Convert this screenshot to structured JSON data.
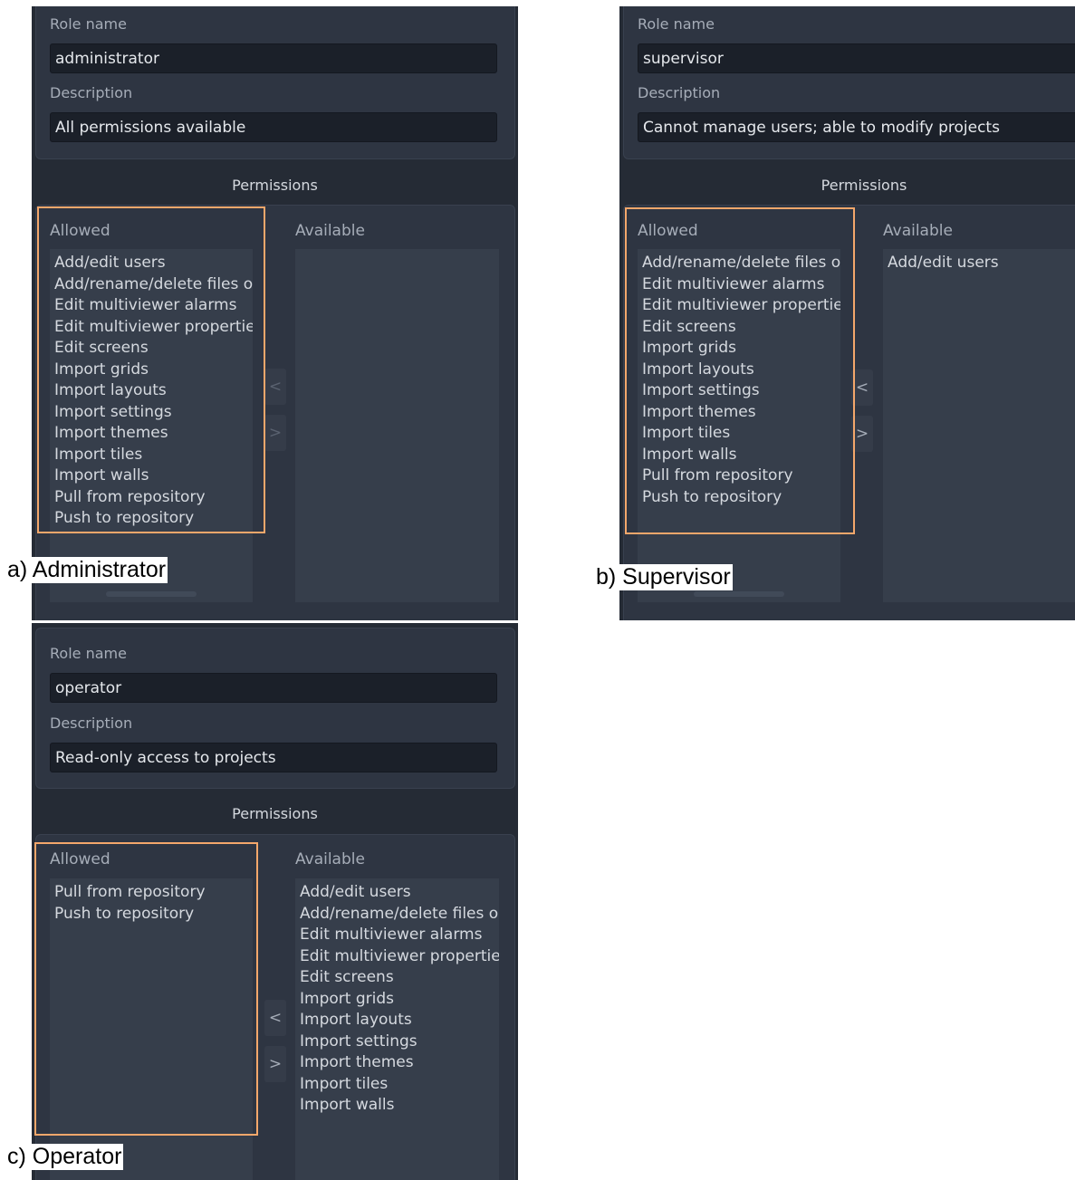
{
  "labels": {
    "role_name": "Role name",
    "description": "Description",
    "permissions": "Permissions",
    "allowed": "Allowed",
    "available": "Available",
    "move_left": "<",
    "move_right": ">"
  },
  "panels": [
    {
      "caption": "a) Administrator",
      "role_name": "administrator",
      "description": "All permissions available",
      "allowed": [
        "Add/edit users",
        "Add/rename/delete files o",
        "Edit multiviewer alarms",
        "Edit multiviewer properties",
        "Edit screens",
        "Import grids",
        "Import layouts",
        "Import settings",
        "Import themes",
        "Import tiles",
        "Import walls",
        "Pull from repository",
        "Push to repository"
      ],
      "available": []
    },
    {
      "caption": "b) Supervisor",
      "role_name": "supervisor",
      "description": "Cannot manage users; able to modify projects",
      "allowed": [
        "Add/rename/delete files o",
        "Edit multiviewer alarms",
        "Edit multiviewer properties",
        "Edit screens",
        "Import grids",
        "Import layouts",
        "Import settings",
        "Import themes",
        "Import tiles",
        "Import walls",
        "Pull from repository",
        "Push to repository"
      ],
      "available": [
        "Add/edit users"
      ]
    },
    {
      "caption": "c) Operator",
      "role_name": "operator",
      "description": "Read-only access to projects",
      "allowed": [
        "Pull from repository",
        "Push to repository"
      ],
      "available": [
        "Add/edit users",
        "Add/rename/delete files o",
        "Edit multiviewer alarms",
        "Edit multiviewer properties",
        "Edit screens",
        "Import grids",
        "Import layouts",
        "Import settings",
        "Import themes",
        "Import tiles",
        "Import walls"
      ]
    }
  ],
  "colors": {
    "panel_bg": "#252b35",
    "box_bg": "#2e3542",
    "list_bg": "#363e4b",
    "highlight": "#f4a76b"
  }
}
